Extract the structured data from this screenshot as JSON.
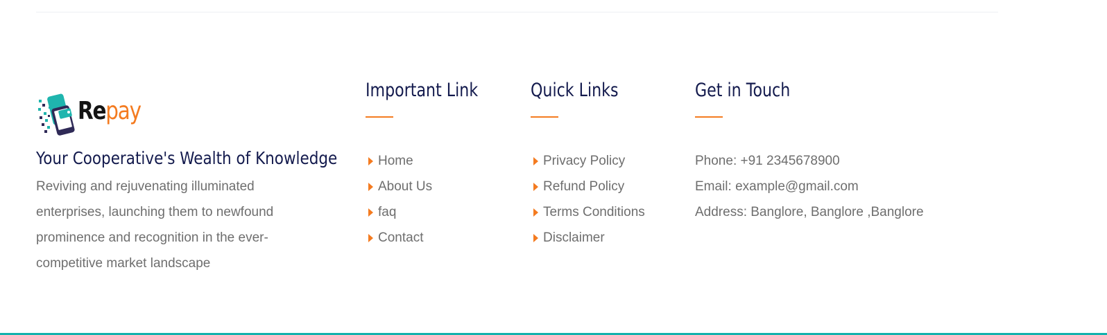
{
  "brand": {
    "logo_re": "Re",
    "logo_pay": "pay",
    "tagline": "Your Cooperative's Wealth of Knowledge",
    "description": "Reviving and rejuvenating illuminated enterprises, launching them to newfound prominence and recognition in the ever-competitive market landscape"
  },
  "important_links": {
    "title": "Important Link",
    "items": [
      "Home",
      "About Us",
      "faq",
      "Contact"
    ]
  },
  "quick_links": {
    "title": "Quick Links",
    "items": [
      "Privacy Policy",
      "Refund Policy",
      "Terms Conditions",
      "Disclaimer"
    ]
  },
  "get_in_touch": {
    "title": "Get in Touch",
    "phone": "Phone: +91 2345678900",
    "email": "Email: example@gmail.com",
    "address": "Address: Banglore, Banglore ,Banglore"
  },
  "colors": {
    "heading": "#131a4d",
    "accent": "#f47b20",
    "text": "#6e6e6e",
    "bottom_strip": "#13b1ad"
  },
  "icons": {
    "list_bullet": "caret-right-icon",
    "logo": "phone-wallet-logo-icon"
  }
}
